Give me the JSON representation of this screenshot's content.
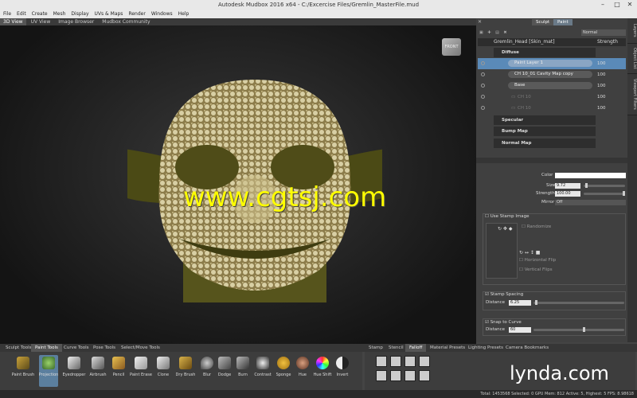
{
  "window": {
    "title": "Autodesk Mudbox 2016 x64 -  C:/Excercise Files/Gremlin_MasterFile.mud"
  },
  "menu": [
    "File",
    "Edit",
    "Create",
    "Mesh",
    "Display",
    "UVs & Maps",
    "Render",
    "Windows",
    "Help"
  ],
  "view_tabs": [
    "3D View",
    "UV View",
    "Image Browser",
    "Mudbox Community"
  ],
  "viewport": {
    "cube_label": "FRONT",
    "watermark": "www.cgtsj.com"
  },
  "panel": {
    "sculpt_tab": "Sculpt",
    "paint_tab": "Paint",
    "blend_mode": "Normal",
    "object_name": "Gremlin_Head [Skin_mat]",
    "strength_header": "Strength",
    "groups": [
      "Diffuse",
      "Specular",
      "Bump Map",
      "Normal Map"
    ],
    "layers": [
      {
        "name": "Paint Layer 1",
        "value": "100"
      },
      {
        "name": "CH 10_01 Cavity Map copy",
        "value": "100"
      },
      {
        "name": "Base",
        "value": "100"
      },
      {
        "name": "CH 10",
        "value": "100"
      },
      {
        "name": "CH 10",
        "value": "100"
      }
    ]
  },
  "side_tabs": [
    "Layers",
    "Object List",
    "Viewport Filters"
  ],
  "props": {
    "color_label": "Color",
    "size_label": "Size",
    "size_value": "9.72",
    "strength_label": "Strength",
    "strength_value": "100.00",
    "mirror_label": "Mirror",
    "mirror_value": "Off",
    "stamp_image_label": "Use Stamp Image",
    "randomize_label": "Randomize",
    "hflip_label": "Horizontal Flip",
    "vflip_label": "Vertical Flips",
    "stamp_spacing_label": "Stamp Spacing",
    "distance_label": "Distance",
    "distance_value": "6.25",
    "snap_label": "Snap to Curve",
    "distance2_label": "Distance",
    "distance2_value": "60"
  },
  "bottom_tabs_left": [
    "Sculpt Tools",
    "Paint Tools",
    "Curve Tools",
    "Pose Tools",
    "Select/Move Tools"
  ],
  "bottom_tabs_right": [
    "Stamp",
    "Stencil",
    "Falloff",
    "Material Presets",
    "Lighting Presets",
    "Camera Bookmarks"
  ],
  "tools": [
    "Paint Brush",
    "Projection",
    "Eyedropper",
    "Airbrush",
    "Pencil",
    "Paint Erase",
    "Clone",
    "Dry Brush",
    "Blur",
    "Dodge",
    "Burn",
    "Contrast",
    "Sponge",
    "Hue",
    "Hue Shift",
    "Invert"
  ],
  "status": "Total: 1453568  Selected: 0 GPU Mem: 812  Active: 5, Highest: 5  FPS: 8.98618",
  "brand": "lynda.com"
}
